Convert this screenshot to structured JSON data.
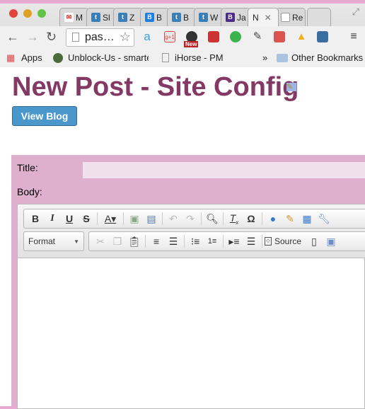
{
  "browser": {
    "tabs": [
      {
        "label": "M",
        "icon": "gmail-icon",
        "color": "#d93025"
      },
      {
        "label": "Sl",
        "icon": "tiki-icon",
        "color": "#3a7fb5"
      },
      {
        "label": "Z",
        "icon": "tiki-icon",
        "color": "#3a7fb5"
      },
      {
        "label": "B",
        "icon": "b-icon",
        "color": "#1d7fe0"
      },
      {
        "label": "B",
        "icon": "tiki-icon",
        "color": "#3a7fb5"
      },
      {
        "label": "W",
        "icon": "tiki-icon",
        "color": "#3a7fb5"
      },
      {
        "label": "Ja",
        "icon": "bootstrap-icon",
        "color": "#4b2e83"
      },
      {
        "label": "N",
        "icon": "",
        "color": "",
        "active": true
      },
      {
        "label": "Re",
        "icon": "page-icon",
        "color": "#fff"
      }
    ],
    "address": "pas…",
    "bookmarks": {
      "apps": "Apps",
      "items": [
        "Unblock-Us - smarte",
        "iHorse - PM"
      ],
      "overflow": "»",
      "other": "Other Bookmarks"
    },
    "new_badge": "New"
  },
  "page": {
    "title": "New Post - Site Config",
    "view_blog": "View Blog"
  },
  "form": {
    "title_label": "Title:",
    "title_value": "",
    "body_label": "Body:"
  },
  "editor": {
    "format_label": "Format",
    "source_label": "Source"
  }
}
